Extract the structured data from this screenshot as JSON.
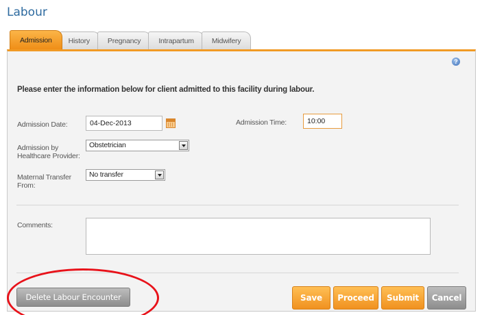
{
  "page": {
    "title": "Labour"
  },
  "tabs": [
    {
      "label": "Admission",
      "active": true
    },
    {
      "label": "History",
      "active": false
    },
    {
      "label": "Pregnancy",
      "active": false
    },
    {
      "label": "Intrapartum",
      "active": false
    },
    {
      "label": "Midwifery",
      "active": false
    }
  ],
  "form": {
    "instruction": "Please enter the information below for client admitted to this facility during labour.",
    "admission_date": {
      "label": "Admission Date:",
      "value": "04-Dec-2013"
    },
    "admission_time": {
      "label": "Admission Time:",
      "value": "10:00"
    },
    "admission_by": {
      "label": "Admission by Healthcare Provider:",
      "value": "Obstetrician"
    },
    "maternal_transfer": {
      "label": "Maternal Transfer From:",
      "value": "No transfer"
    },
    "comments": {
      "label": "Comments:",
      "value": ""
    }
  },
  "actions": {
    "delete_label": "Delete Labour Encounter",
    "save_label": "Save",
    "proceed_label": "Proceed",
    "submit_label": "Submit",
    "cancel_label": "Cancel"
  },
  "icons": {
    "help": "help-icon",
    "calendar": "calendar-icon",
    "dropdown": "chevron-down-icon"
  },
  "colors": {
    "title": "#2d6a9f",
    "accent": "#f0911f",
    "grey_button": "#8d8d8d",
    "highlight": "#e8121a"
  }
}
